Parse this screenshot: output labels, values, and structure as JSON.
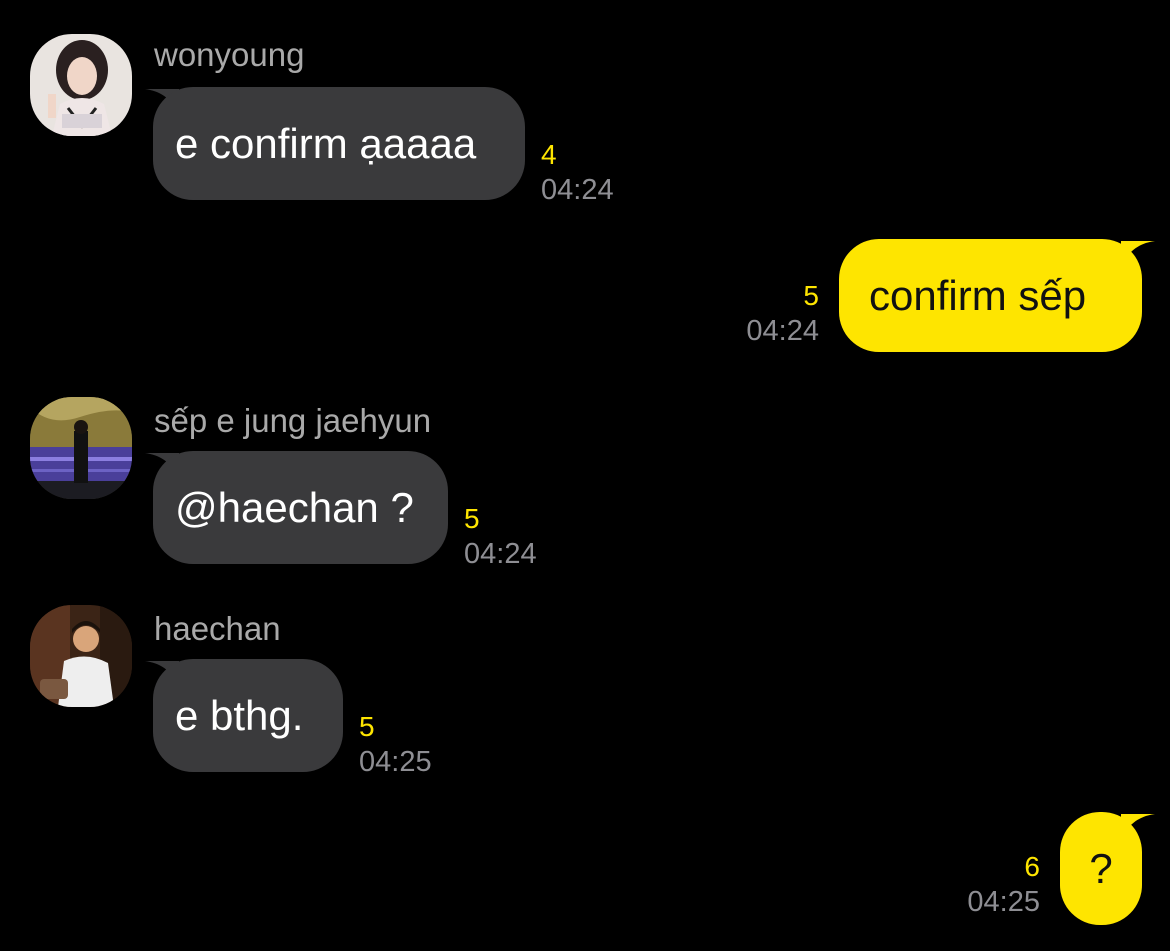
{
  "colors": {
    "background": "#000000",
    "incoming_bubble": "#3a3a3c",
    "outgoing_bubble": "#fee500",
    "unread_count": "#fee500",
    "timestamp": "#8e8e93",
    "sender_name": "#a9a9a9"
  },
  "messages": [
    {
      "sender": "wonyoung",
      "text": "e confirm ạaaaa",
      "unread": "4",
      "time": "04:24",
      "avatar": "avatar-wonyoung-icon"
    },
    {
      "text": "confirm sếp",
      "unread": "5",
      "time": "04:24"
    },
    {
      "sender": "sếp e jung jaehyun",
      "text": "@haechan ?",
      "unread": "5",
      "time": "04:24",
      "avatar": "avatar-jaehyun-icon"
    },
    {
      "sender": "haechan",
      "text": "e bthg.",
      "unread": "5",
      "time": "04:25",
      "avatar": "avatar-haechan-icon"
    },
    {
      "text": "?",
      "unread": "6",
      "time": "04:25"
    }
  ]
}
